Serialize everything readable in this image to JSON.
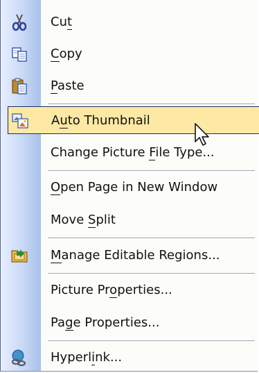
{
  "menu": {
    "items": [
      {
        "pre": "Cu",
        "key": "t",
        "post": "",
        "icon": "scissors-icon"
      },
      {
        "pre": "",
        "key": "C",
        "post": "opy",
        "icon": "copy-icon"
      },
      {
        "pre": "",
        "key": "P",
        "post": "aste",
        "icon": "paste-icon"
      },
      {
        "pre": "A",
        "key": "u",
        "post": "to Thumbnail",
        "icon": "auto-thumbnail-icon"
      },
      {
        "pre": "Change Picture ",
        "key": "F",
        "post": "ile Type...",
        "icon": ""
      },
      {
        "pre": "",
        "key": "O",
        "post": "pen Page in New Window",
        "icon": ""
      },
      {
        "pre": "Move ",
        "key": "S",
        "post": "plit",
        "icon": ""
      },
      {
        "pre": "",
        "key": "M",
        "post": "anage Editable Regions...",
        "icon": "editable-regions-icon"
      },
      {
        "pre": "Picture Pr",
        "key": "o",
        "post": "perties...",
        "icon": ""
      },
      {
        "pre": "Pa",
        "key": "g",
        "post": "e Properties...",
        "icon": ""
      },
      {
        "pre": "Hyperl",
        "key": "i",
        "post": "nk...",
        "icon": "hyperlink-icon"
      }
    ]
  },
  "colors": {
    "highlight_fill": "#fde8a4",
    "highlight_border": "#1d2c5c",
    "gutter": "#c9d9f6"
  }
}
